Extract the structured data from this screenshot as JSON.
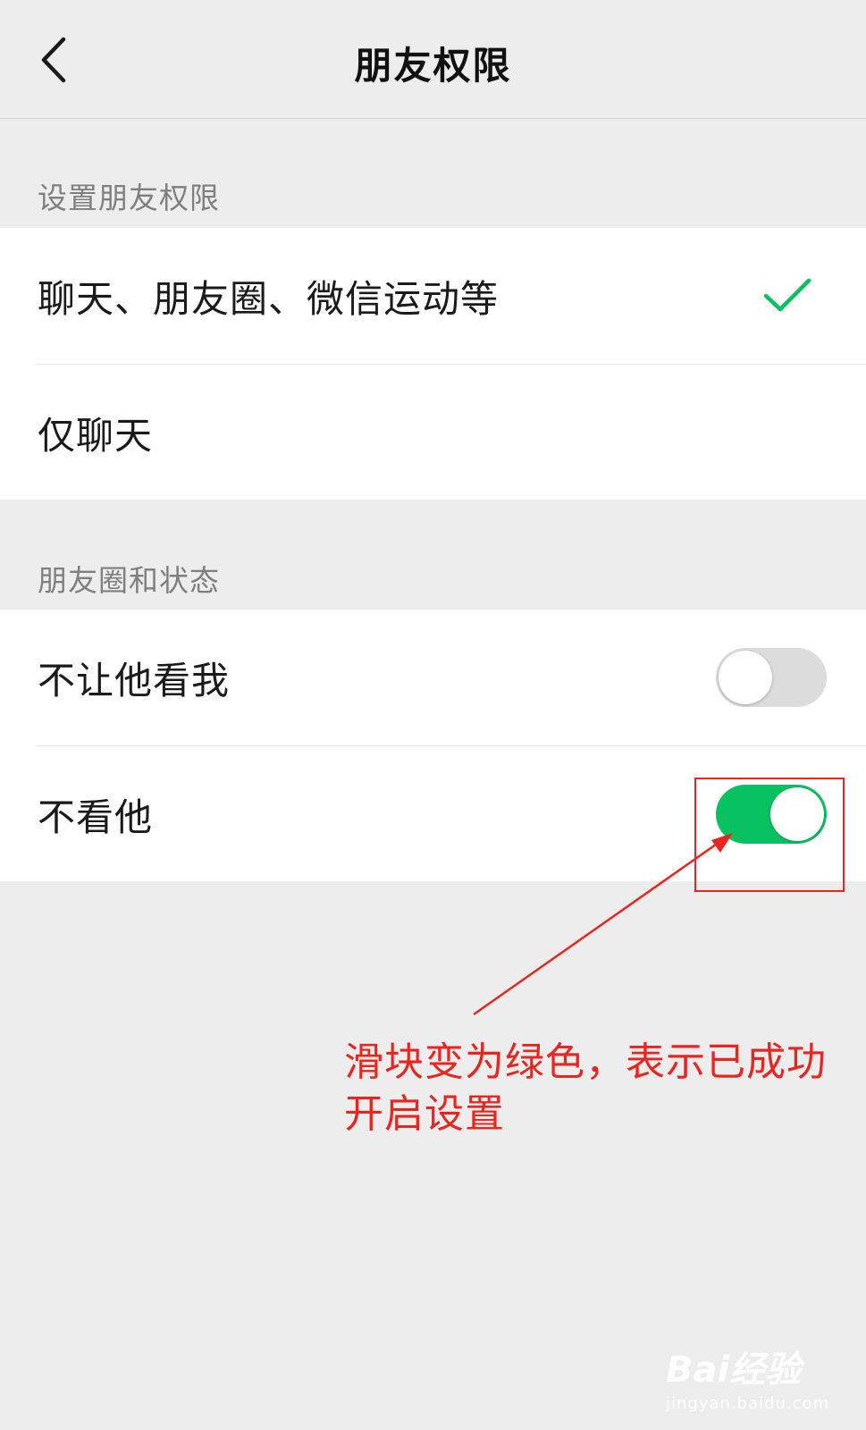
{
  "header": {
    "title": "朋友权限"
  },
  "sections": [
    {
      "label": "设置朋友权限",
      "options": [
        {
          "label": "聊天、朋友圈、微信运动等",
          "selected": true
        },
        {
          "label": "仅聊天",
          "selected": false
        }
      ]
    },
    {
      "label": "朋友圈和状态",
      "toggles": [
        {
          "label": "不让他看我",
          "on": false
        },
        {
          "label": "不看他",
          "on": true
        }
      ]
    }
  ],
  "annotation": {
    "line1": "滑块变为绿色，表示已成功",
    "line2": "开启设置"
  },
  "watermark": {
    "logo": "Bai经验",
    "url": "jingyan.baidu.com"
  },
  "colors": {
    "accent_green": "#07c160",
    "annotation_red": "#e8261f",
    "background": "#ededed"
  }
}
